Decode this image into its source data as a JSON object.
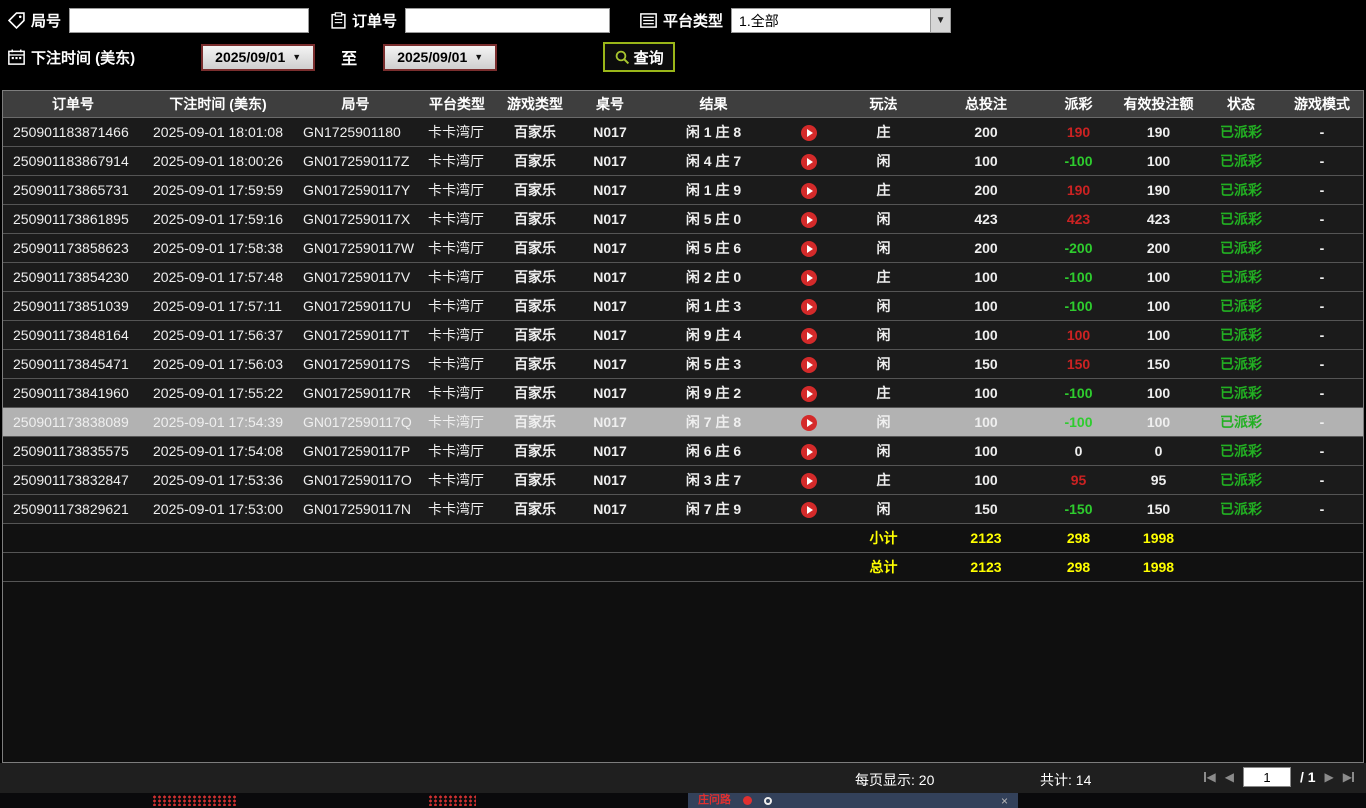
{
  "filters": {
    "round": {
      "label": "局号",
      "value": ""
    },
    "order": {
      "label": "订单号",
      "value": ""
    },
    "platform": {
      "label": "平台类型",
      "value": "1.全部"
    },
    "bet_time": {
      "label": "下注时间 (美东)",
      "from": "2025/09/01",
      "to_label": "至",
      "to": "2025/09/01"
    },
    "query_label": "查询"
  },
  "icons": {
    "round_field": "tag-icon",
    "order_field": "clipboard-icon",
    "platform_field": "list-icon",
    "bet_time_field": "calendar-icon",
    "query_button": "magnifier-icon",
    "result_replay": "play-icon",
    "dropdown_arrow": "▼",
    "pager": [
      "first-page-icon",
      "prev-page-icon",
      "next-page-icon",
      "last-page-icon"
    ]
  },
  "table": {
    "headers": [
      "订单号",
      "下注时间 (美东)",
      "局号",
      "平台类型",
      "游戏类型",
      "桌号",
      "结果",
      "玩法",
      "总投注",
      "派彩",
      "有效投注额",
      "状态",
      "游戏模式"
    ],
    "rows": [
      {
        "order": "250901183871466",
        "time": "2025-09-01 18:01:08",
        "round": "GN1725901180",
        "platform": "卡卡湾厅",
        "game": "百家乐",
        "table_no": "N017",
        "result": "闲 1 庄 8",
        "play": "庄",
        "total_bet": "200",
        "payout": "190",
        "payout_color": "win",
        "valid_bet": "190",
        "status": "已派彩",
        "mode": "-",
        "selected": false
      },
      {
        "order": "250901183867914",
        "time": "2025-09-01 18:00:26",
        "round": "GN0172590117Z",
        "platform": "卡卡湾厅",
        "game": "百家乐",
        "table_no": "N017",
        "result": "闲 4 庄 7",
        "play": "闲",
        "total_bet": "100",
        "payout": "-100",
        "payout_color": "loss",
        "valid_bet": "100",
        "status": "已派彩",
        "mode": "-",
        "selected": false
      },
      {
        "order": "250901173865731",
        "time": "2025-09-01 17:59:59",
        "round": "GN0172590117Y",
        "platform": "卡卡湾厅",
        "game": "百家乐",
        "table_no": "N017",
        "result": "闲 1 庄 9",
        "play": "庄",
        "total_bet": "200",
        "payout": "190",
        "payout_color": "win",
        "valid_bet": "190",
        "status": "已派彩",
        "mode": "-",
        "selected": false
      },
      {
        "order": "250901173861895",
        "time": "2025-09-01 17:59:16",
        "round": "GN0172590117X",
        "platform": "卡卡湾厅",
        "game": "百家乐",
        "table_no": "N017",
        "result": "闲 5 庄 0",
        "play": "闲",
        "total_bet": "423",
        "payout": "423",
        "payout_color": "win",
        "valid_bet": "423",
        "status": "已派彩",
        "mode": "-",
        "selected": false
      },
      {
        "order": "250901173858623",
        "time": "2025-09-01 17:58:38",
        "round": "GN0172590117W",
        "platform": "卡卡湾厅",
        "game": "百家乐",
        "table_no": "N017",
        "result": "闲 5 庄 6",
        "play": "闲",
        "total_bet": "200",
        "payout": "-200",
        "payout_color": "loss",
        "valid_bet": "200",
        "status": "已派彩",
        "mode": "-",
        "selected": false
      },
      {
        "order": "250901173854230",
        "time": "2025-09-01 17:57:48",
        "round": "GN0172590117V",
        "platform": "卡卡湾厅",
        "game": "百家乐",
        "table_no": "N017",
        "result": "闲 2 庄 0",
        "play": "庄",
        "total_bet": "100",
        "payout": "-100",
        "payout_color": "loss",
        "valid_bet": "100",
        "status": "已派彩",
        "mode": "-",
        "selected": false
      },
      {
        "order": "250901173851039",
        "time": "2025-09-01 17:57:11",
        "round": "GN0172590117U",
        "platform": "卡卡湾厅",
        "game": "百家乐",
        "table_no": "N017",
        "result": "闲 1 庄 3",
        "play": "闲",
        "total_bet": "100",
        "payout": "-100",
        "payout_color": "loss",
        "valid_bet": "100",
        "status": "已派彩",
        "mode": "-",
        "selected": false
      },
      {
        "order": "250901173848164",
        "time": "2025-09-01 17:56:37",
        "round": "GN0172590117T",
        "platform": "卡卡湾厅",
        "game": "百家乐",
        "table_no": "N017",
        "result": "闲 9 庄 4",
        "play": "闲",
        "total_bet": "100",
        "payout": "100",
        "payout_color": "win",
        "valid_bet": "100",
        "status": "已派彩",
        "mode": "-",
        "selected": false
      },
      {
        "order": "250901173845471",
        "time": "2025-09-01 17:56:03",
        "round": "GN0172590117S",
        "platform": "卡卡湾厅",
        "game": "百家乐",
        "table_no": "N017",
        "result": "闲 5 庄 3",
        "play": "闲",
        "total_bet": "150",
        "payout": "150",
        "payout_color": "win",
        "valid_bet": "150",
        "status": "已派彩",
        "mode": "-",
        "selected": false
      },
      {
        "order": "250901173841960",
        "time": "2025-09-01 17:55:22",
        "round": "GN0172590117R",
        "platform": "卡卡湾厅",
        "game": "百家乐",
        "table_no": "N017",
        "result": "闲 9 庄 2",
        "play": "庄",
        "total_bet": "100",
        "payout": "-100",
        "payout_color": "loss",
        "valid_bet": "100",
        "status": "已派彩",
        "mode": "-",
        "selected": false
      },
      {
        "order": "250901173838089",
        "time": "2025-09-01 17:54:39",
        "round": "GN0172590117Q",
        "platform": "卡卡湾厅",
        "game": "百家乐",
        "table_no": "N017",
        "result": "闲 7 庄 8",
        "play": "闲",
        "total_bet": "100",
        "payout": "-100",
        "payout_color": "loss",
        "valid_bet": "100",
        "status": "已派彩",
        "mode": "-",
        "selected": true
      },
      {
        "order": "250901173835575",
        "time": "2025-09-01 17:54:08",
        "round": "GN0172590117P",
        "platform": "卡卡湾厅",
        "game": "百家乐",
        "table_no": "N017",
        "result": "闲 6 庄 6",
        "play": "闲",
        "total_bet": "100",
        "payout": "0",
        "payout_color": "zero",
        "valid_bet": "0",
        "status": "已派彩",
        "mode": "-",
        "selected": false
      },
      {
        "order": "250901173832847",
        "time": "2025-09-01 17:53:36",
        "round": "GN0172590117O",
        "platform": "卡卡湾厅",
        "game": "百家乐",
        "table_no": "N017",
        "result": "闲 3 庄 7",
        "play": "庄",
        "total_bet": "100",
        "payout": "95",
        "payout_color": "win",
        "valid_bet": "95",
        "status": "已派彩",
        "mode": "-",
        "selected": false
      },
      {
        "order": "250901173829621",
        "time": "2025-09-01 17:53:00",
        "round": "GN0172590117N",
        "platform": "卡卡湾厅",
        "game": "百家乐",
        "table_no": "N017",
        "result": "闲 7 庄 9",
        "play": "闲",
        "total_bet": "150",
        "payout": "-150",
        "payout_color": "loss",
        "valid_bet": "150",
        "status": "已派彩",
        "mode": "-",
        "selected": false
      }
    ],
    "subtotal": {
      "label": "小计",
      "total_bet": "2123",
      "payout": "298",
      "valid_bet": "1998"
    },
    "grand_total": {
      "label": "总计",
      "total_bet": "2123",
      "payout": "298",
      "valid_bet": "1998"
    }
  },
  "footer": {
    "per_page": "每页显示: 20",
    "total_count": "共计: 14",
    "page": "1",
    "page_of": "/  1"
  },
  "bottom_strip": {
    "label": "庄问路"
  },
  "colors": {
    "win_red": "#cc2222",
    "loss_green": "#2ecc2e",
    "status_green": "#22b022",
    "summary_yellow": "#ffff00",
    "selected_row_bg": "#b2b2b2",
    "query_border": "#9ab619",
    "play_button_red": "#d42a2a"
  }
}
